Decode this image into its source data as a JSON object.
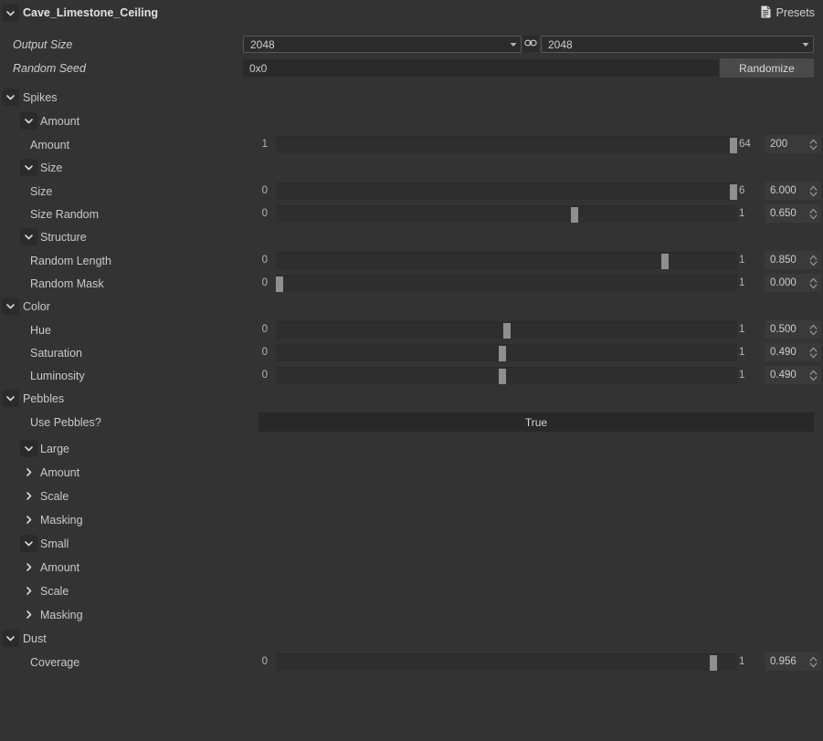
{
  "window": {
    "title": "Cave_Limestone_Ceiling",
    "presets_label": "Presets",
    "presets_icon": "document-list-icon",
    "link_icon": "chain-link-icon"
  },
  "top_fields": {
    "output_size": {
      "label": "Output Size",
      "width_value": "2048",
      "height_value": "2048",
      "arrow_icon": "caret-down-icon"
    },
    "random_seed": {
      "label": "Random Seed",
      "value": "0x0",
      "button_label": "Randomize"
    }
  },
  "colors": {
    "background": "#333333",
    "track": "#2e2e2e",
    "handle": "#8f8f8f",
    "numbox": "#3a3a3a",
    "button": "#4a4a4a",
    "bool_button": "#282828",
    "text": "#c9c9c9"
  },
  "sections": [
    {
      "id": "spikes",
      "label": "Spikes",
      "expanded": true,
      "groups": [
        {
          "id": "spikes-amount",
          "label": "Amount",
          "expanded": true,
          "params": [
            {
              "label": "Amount",
              "min": "1",
              "max": "64",
              "value": "200",
              "fill": 1.0
            }
          ]
        },
        {
          "id": "spikes-size",
          "label": "Size",
          "expanded": true,
          "params": [
            {
              "label": "Size",
              "min": "0",
              "max": "6",
              "value": "6.000",
              "fill": 1.0
            },
            {
              "label": "Size Random",
              "min": "0",
              "max": "1",
              "value": "0.650",
              "fill": 0.65
            }
          ]
        },
        {
          "id": "spikes-structure",
          "label": "Structure",
          "expanded": true,
          "params": [
            {
              "label": "Random Length",
              "min": "0",
              "max": "1",
              "value": "0.850",
              "fill": 0.85
            },
            {
              "label": "Random Mask",
              "min": "0",
              "max": "1",
              "value": "0.000",
              "fill": 0.0
            }
          ]
        }
      ]
    },
    {
      "id": "color",
      "label": "Color",
      "expanded": true,
      "groups": [
        {
          "id": "color-params",
          "label": null,
          "expanded": true,
          "params": [
            {
              "label": "Hue",
              "min": "0",
              "max": "1",
              "value": "0.500",
              "fill": 0.5
            },
            {
              "label": "Saturation",
              "min": "0",
              "max": "1",
              "value": "0.490",
              "fill": 0.49
            },
            {
              "label": "Luminosity",
              "min": "0",
              "max": "1",
              "value": "0.490",
              "fill": 0.49
            }
          ]
        }
      ]
    },
    {
      "id": "pebbles",
      "label": "Pebbles",
      "expanded": true,
      "bool_param": {
        "label": "Use Pebbles?",
        "value": "True"
      },
      "subgroups": [
        {
          "id": "pebbles-large",
          "label": "Large",
          "expanded": true,
          "children": [
            {
              "label": "Amount",
              "expanded": false
            },
            {
              "label": "Scale",
              "expanded": false
            },
            {
              "label": "Masking",
              "expanded": false
            }
          ]
        },
        {
          "id": "pebbles-small",
          "label": "Small",
          "expanded": true,
          "children": [
            {
              "label": "Amount",
              "expanded": false
            },
            {
              "label": "Scale",
              "expanded": false
            },
            {
              "label": "Masking",
              "expanded": false
            }
          ]
        }
      ]
    },
    {
      "id": "dust",
      "label": "Dust",
      "expanded": true,
      "groups": [
        {
          "id": "dust-params",
          "label": null,
          "expanded": true,
          "params": [
            {
              "label": "Coverage",
              "min": "0",
              "max": "1",
              "value": "0.956",
              "fill": 0.956
            }
          ]
        }
      ]
    }
  ]
}
